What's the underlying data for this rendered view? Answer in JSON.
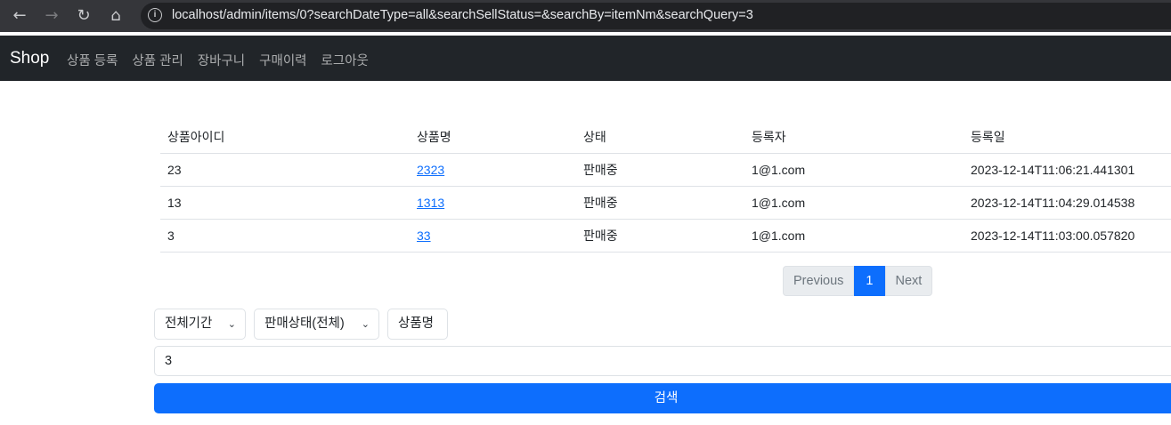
{
  "browser": {
    "url_host": "localhost",
    "url_path": "/admin/items/0?searchDateType=all&searchSellStatus=&searchBy=itemNm&searchQuery=3",
    "back_glyph": "←",
    "forward_glyph": "→",
    "reload_glyph": "↻",
    "home_glyph": "⌂",
    "info_glyph": "i"
  },
  "navbar": {
    "brand": "Shop",
    "links": [
      "상품 등록",
      "상품 관리",
      "장바구니",
      "구매이력",
      "로그아웃"
    ]
  },
  "table": {
    "headers": [
      "상품아이디",
      "상품명",
      "상태",
      "등록자",
      "등록일"
    ],
    "rows": [
      {
        "id": "23",
        "name": "2323",
        "status": "판매중",
        "registrant": "1@1.com",
        "date": "2023-12-14T11:06:21.441301"
      },
      {
        "id": "13",
        "name": "1313",
        "status": "판매중",
        "registrant": "1@1.com",
        "date": "2023-12-14T11:04:29.014538"
      },
      {
        "id": "3",
        "name": "33",
        "status": "판매중",
        "registrant": "1@1.com",
        "date": "2023-12-14T11:03:00.057820"
      }
    ]
  },
  "pagination": {
    "previous": "Previous",
    "current": "1",
    "next": "Next"
  },
  "search": {
    "date_type": "전체기간",
    "sell_status": "판매상태(전체)",
    "search_by": "상품명",
    "query": "3",
    "submit": "검색",
    "chevron": "⌄"
  },
  "colors": {
    "primary": "#0d6efd",
    "navbar_bg": "#212529",
    "chrome_bg": "#35363a"
  }
}
